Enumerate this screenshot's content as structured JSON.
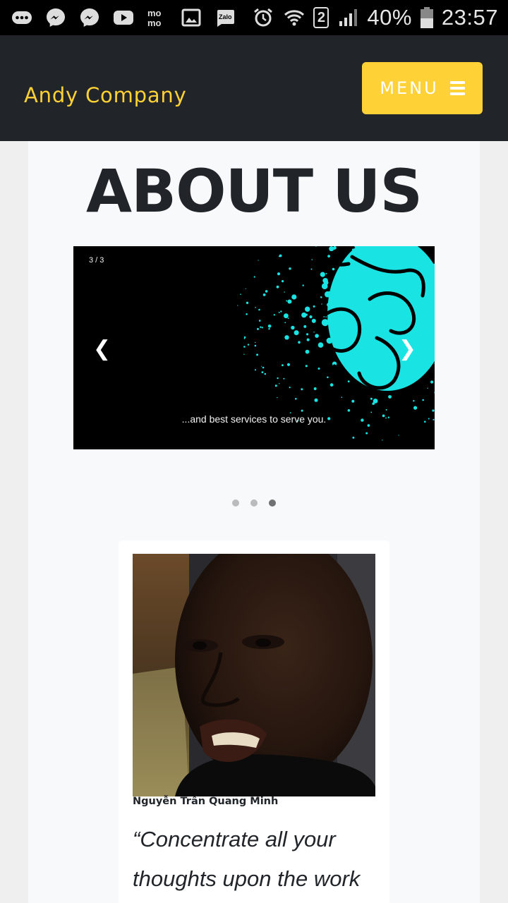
{
  "status_bar": {
    "battery": "40%",
    "time": "23:57",
    "sim": "2",
    "left_icons": [
      "more-icon",
      "messenger-icon",
      "messenger-icon",
      "youtube-icon",
      "momo-icon",
      "gallery-icon",
      "zalo-icon"
    ],
    "momo_text": "mo mo",
    "zalo_text": "Zalo"
  },
  "header": {
    "brand": "Andy Company",
    "menu_label": "MENU",
    "menu_icon": "bars-icon"
  },
  "about": {
    "title": "ABOUT US"
  },
  "slideshow": {
    "counter": "3 / 3",
    "caption": "...and best services to serve you.",
    "prev": "❮",
    "next": "❯",
    "dots": 3,
    "active_index": 3
  },
  "team": {
    "name": "Nguyễn Trần Quang Minh",
    "quote": "“Concentrate all your thoughts upon the work"
  },
  "colors": {
    "accent": "#fed136",
    "header_bg": "#212529",
    "splatter": "#19e3e3",
    "dot_inactive": "#bbbbbb",
    "dot_active": "#717171"
  }
}
